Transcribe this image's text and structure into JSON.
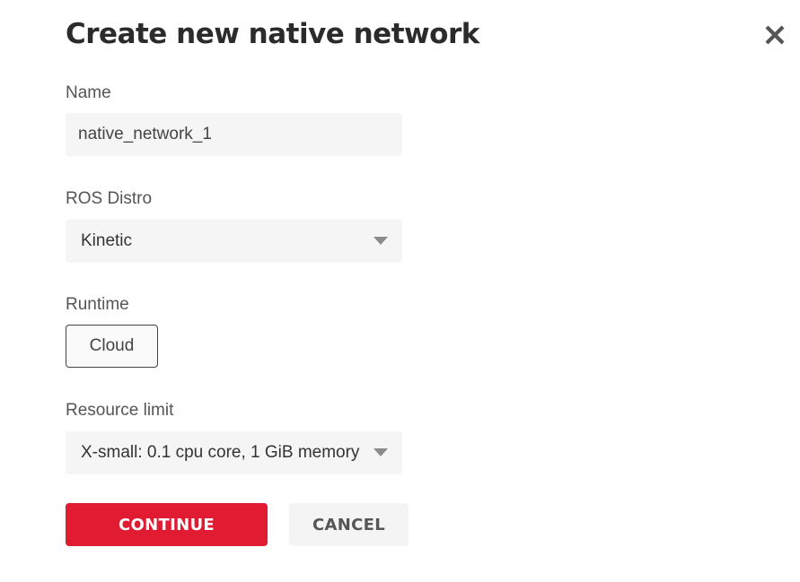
{
  "dialog": {
    "title": "Create new native network",
    "close_icon": "close-icon"
  },
  "form": {
    "name": {
      "label": "Name",
      "value": "native_network_1"
    },
    "ros_distro": {
      "label": "ROS Distro",
      "selected": "Kinetic"
    },
    "runtime": {
      "label": "Runtime",
      "option": "Cloud"
    },
    "resource_limit": {
      "label": "Resource limit",
      "selected": "X-small: 0.1 cpu core, 1 GiB memory"
    }
  },
  "actions": {
    "continue_label": "CONTINUE",
    "cancel_label": "CANCEL"
  },
  "colors": {
    "primary": "#e01b32",
    "field_background": "#f5f5f5",
    "cancel_background": "#f4f4f4"
  }
}
